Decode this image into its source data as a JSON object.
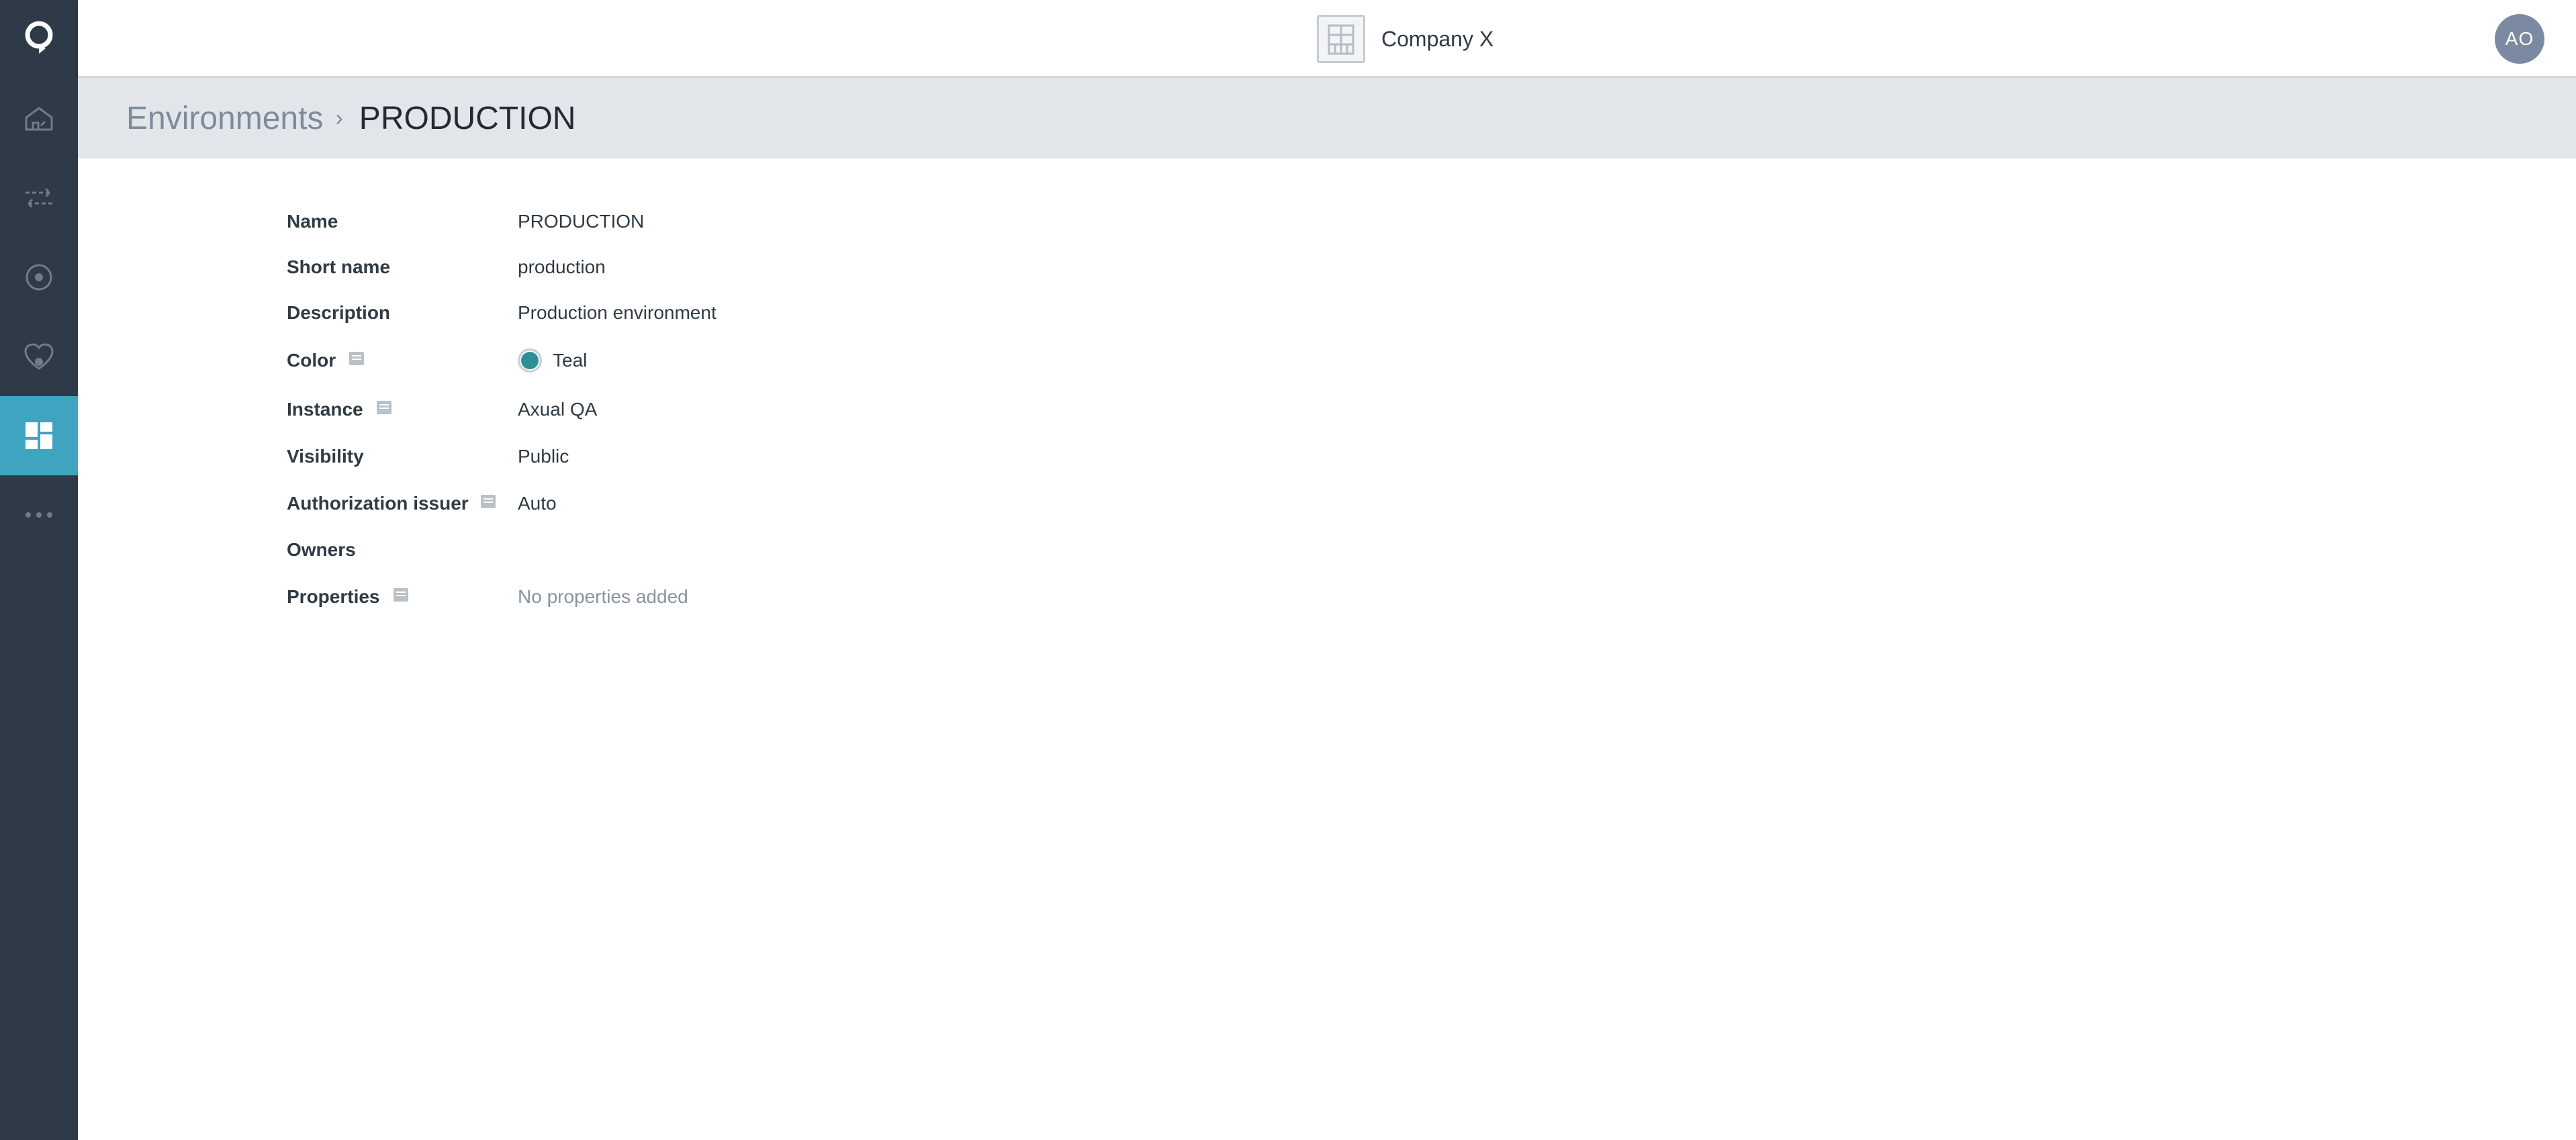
{
  "app": {
    "company_name": "Company X",
    "user_initials": "AO"
  },
  "sidebar": {
    "logo_icon": "q-logo-icon",
    "items": [
      {
        "name": "home",
        "icon": "home-icon"
      },
      {
        "name": "streams",
        "icon": "arrows-exchange-icon"
      },
      {
        "name": "applications",
        "icon": "target-icon"
      },
      {
        "name": "integrations",
        "icon": "heart-link-icon"
      },
      {
        "name": "environments",
        "icon": "dashboard-grid-icon",
        "active": true
      },
      {
        "name": "more",
        "icon": "ellipsis-icon"
      }
    ]
  },
  "breadcrumb": {
    "parent": "Environments",
    "separator": "›",
    "current": "PRODUCTION"
  },
  "details": {
    "name_label": "Name",
    "name_value": "PRODUCTION",
    "short_name_label": "Short name",
    "short_name_value": "production",
    "description_label": "Description",
    "description_value": "Production environment",
    "color_label": "Color",
    "color_value": "Teal",
    "color_hex": "#2e8f98",
    "instance_label": "Instance",
    "instance_value": "Axual QA",
    "visibility_label": "Visibility",
    "visibility_value": "Public",
    "auth_issuer_label": "Authorization issuer",
    "auth_issuer_value": "Auto",
    "owners_label": "Owners",
    "owners_value": "",
    "properties_label": "Properties",
    "properties_value": "No properties added"
  },
  "colors": {
    "sidebar_bg": "#2e3a47",
    "sidebar_active": "#3fa4c0",
    "breadcrumb_bg": "#e2e6ea",
    "avatar_bg": "#7c8aa1"
  }
}
